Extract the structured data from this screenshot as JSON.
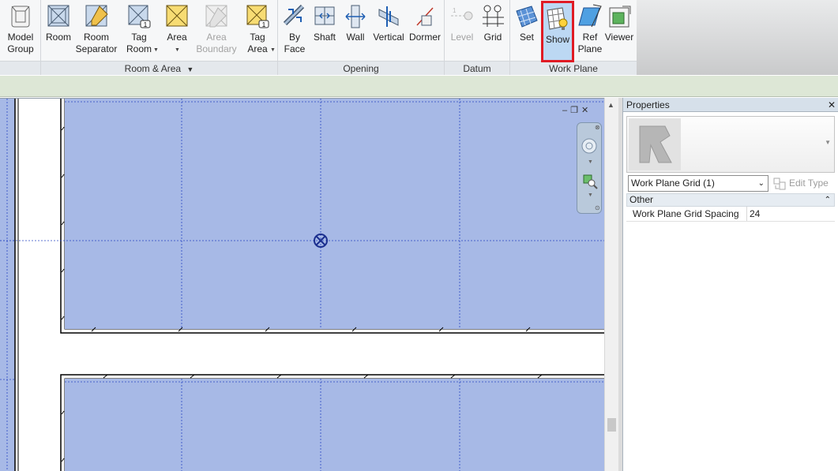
{
  "ribbon": {
    "panels": {
      "build": {
        "tools": [
          {
            "label1": "Model",
            "label2": "Group",
            "has_dropdown": true
          }
        ]
      },
      "room_area": {
        "title": "Room & Area",
        "tools": [
          {
            "label1": "Room",
            "label2": ""
          },
          {
            "label1": "Room",
            "label2": "Separator"
          },
          {
            "label1": "Tag",
            "label2": "Room",
            "has_dropdown": true
          },
          {
            "label1": "Area",
            "label2": "",
            "has_dropdown": true
          },
          {
            "label1": "Area",
            "label2": "Boundary",
            "disabled": true
          },
          {
            "label1": "Tag",
            "label2": "Area",
            "has_dropdown": true
          }
        ]
      },
      "opening": {
        "title": "Opening",
        "tools": [
          {
            "label1": "By",
            "label2": "Face"
          },
          {
            "label1": "Shaft",
            "label2": ""
          },
          {
            "label1": "Wall",
            "label2": ""
          },
          {
            "label1": "Vertical",
            "label2": ""
          },
          {
            "label1": "Dormer",
            "label2": ""
          }
        ]
      },
      "datum": {
        "title": "Datum",
        "tools": [
          {
            "label1": "Level",
            "label2": "",
            "disabled": true
          },
          {
            "label1": "Grid",
            "label2": ""
          }
        ]
      },
      "work_plane": {
        "title": "Work Plane",
        "tools": [
          {
            "label1": "Set",
            "label2": ""
          },
          {
            "label1": "Show",
            "label2": "",
            "highlighted": true
          },
          {
            "label1": "Ref",
            "label2": "Plane"
          },
          {
            "label1": "Viewer",
            "label2": ""
          }
        ]
      }
    }
  },
  "properties": {
    "title": "Properties",
    "type_selector": "Work Plane Grid (1)",
    "edit_type_label": "Edit Type",
    "category": "Other",
    "params": [
      {
        "name": "Work Plane Grid Spacing",
        "value": "24"
      }
    ]
  },
  "colors": {
    "highlight": "#e01b24",
    "work_plane_fill": "#a7b9e6",
    "grid_line": "#2b48c2"
  },
  "icons": [
    "model-group-icon",
    "room-icon",
    "room-separator-icon",
    "tag-room-icon",
    "area-icon",
    "area-boundary-icon",
    "tag-area-icon",
    "by-face-icon",
    "shaft-icon",
    "wall-opening-icon",
    "vertical-icon",
    "dormer-icon",
    "level-icon",
    "grid-icon",
    "set-icon",
    "show-icon",
    "ref-plane-icon",
    "viewer-icon"
  ]
}
